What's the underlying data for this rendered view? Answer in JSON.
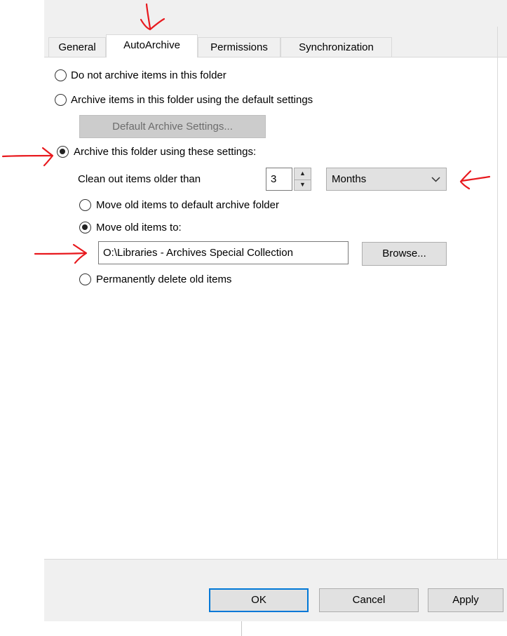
{
  "tabs": [
    {
      "label": "General"
    },
    {
      "label": "AutoArchive"
    },
    {
      "label": "Permissions"
    },
    {
      "label": "Synchronization"
    }
  ],
  "options": {
    "no_archive": "Do not archive items in this folder",
    "default_settings": "Archive items in this folder using the default settings",
    "default_settings_button": "Default Archive Settings...",
    "these_settings": "Archive this folder using these settings:",
    "clean_out_label": "Clean out items older than",
    "clean_out_value": "3",
    "period": "Months",
    "move_default": "Move old items to default archive folder",
    "move_to": "Move old items to:",
    "move_path": "O:\\Libraries - Archives Special Collection",
    "browse": "Browse...",
    "delete": "Permanently delete old items"
  },
  "footer": {
    "ok": "OK",
    "cancel": "Cancel",
    "apply": "Apply"
  },
  "selected": {
    "archive_mode": "these_settings",
    "move_mode": "move_to",
    "active_tab": "AutoArchive"
  },
  "colors": {
    "annotation": "#e8191e",
    "default_button_border": "#0078d7"
  }
}
